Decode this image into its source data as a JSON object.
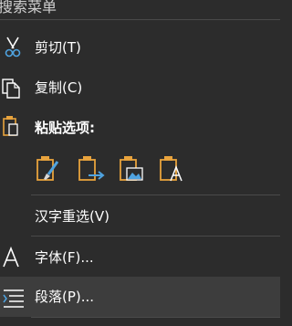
{
  "search": {
    "placeholder": "搜索菜单"
  },
  "items": {
    "cut": {
      "label": "剪切(T)",
      "icon": "scissors-icon"
    },
    "copy": {
      "label": "复制(C)",
      "icon": "copy-icon"
    },
    "paste_header": {
      "label": "粘贴选项:",
      "icon": "clipboard-icon"
    },
    "convert": {
      "label": "汉字重选(V)"
    },
    "font": {
      "label": "字体(F)...",
      "icon": "font-icon"
    },
    "paragraph": {
      "label": "段落(P)...",
      "icon": "paragraph-icon"
    }
  },
  "paste_options": [
    {
      "name": "keep-source-formatting",
      "icon": "paste-brush-icon"
    },
    {
      "name": "merge-formatting",
      "icon": "paste-arrow-icon"
    },
    {
      "name": "picture",
      "icon": "paste-picture-icon"
    },
    {
      "name": "keep-text-only",
      "icon": "paste-text-icon"
    }
  ],
  "colors": {
    "background": "#2c2c2c",
    "hover": "#3d3d3d",
    "separator": "#4a4a4a",
    "clipboard": "#e8a33d",
    "accent_blue": "#4fa3e0"
  }
}
